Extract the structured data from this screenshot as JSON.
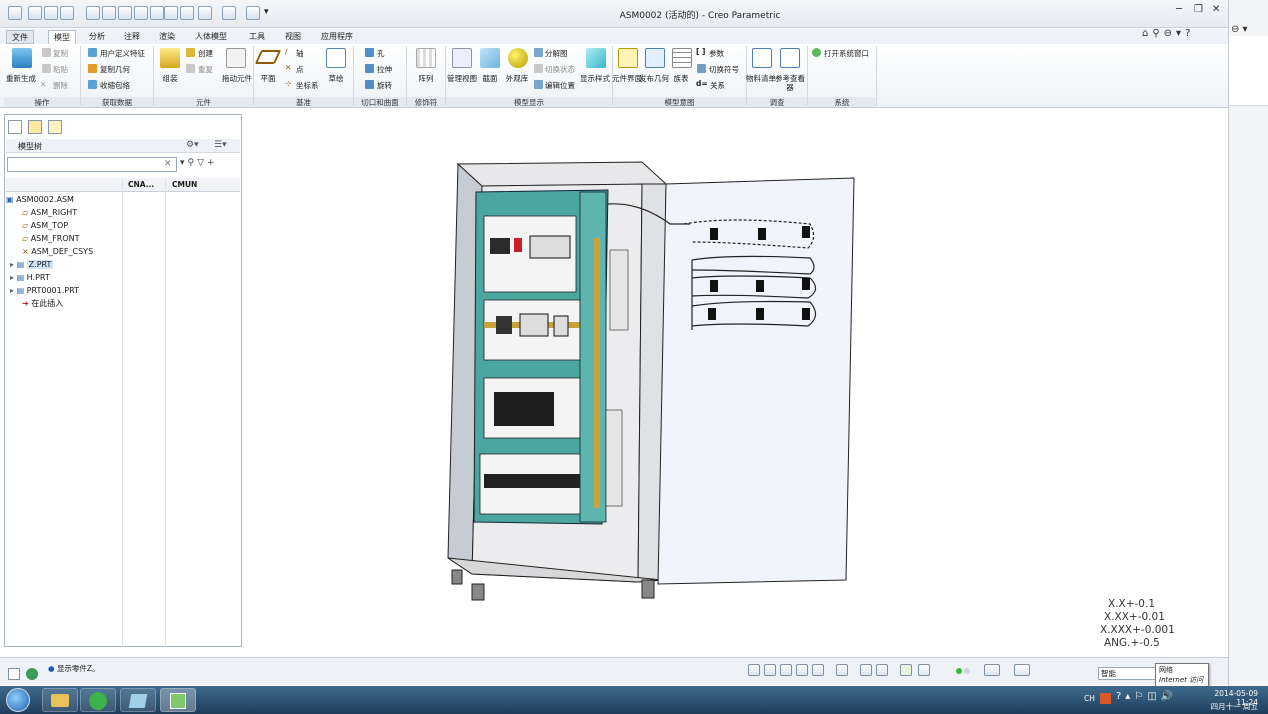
{
  "window": {
    "title": "ASM0002 (活动的) - Creo Parametric"
  },
  "tabs": [
    {
      "label": "文件",
      "file": true
    },
    {
      "label": "模型",
      "active": true
    },
    {
      "label": "分析"
    },
    {
      "label": "注释"
    },
    {
      "label": "渲染"
    },
    {
      "label": "人体模型"
    },
    {
      "label": "工具"
    },
    {
      "label": "视图"
    },
    {
      "label": "应用程序"
    }
  ],
  "ribbon": {
    "regenerate": "重新生成",
    "copy": "复制",
    "paste": "粘贴",
    "delete": "删除",
    "udf": "用户定义特征",
    "copy_geom": "复制几何",
    "shrinkwrap": "收缩包络",
    "assemble": "组装",
    "create": "创建",
    "repeat": "重复",
    "drag": "拖动元件",
    "plane": "平面",
    "axis": "轴",
    "point": "点",
    "csys": "坐标系",
    "sketch": "草绘",
    "hole": "孔",
    "extrude": "拉伸",
    "revolve": "旋转",
    "pattern": "阵列",
    "manage_views": "管理视图",
    "section": "截面",
    "appearance": "外观库",
    "explode": "分解图",
    "toggle_status": "切换状态",
    "edit_position": "编辑位置",
    "display_style": "显示样式",
    "component_interface": "元件界面",
    "publish_geom": "发布几何",
    "table": "族表",
    "parameters": "参数",
    "switch_symbols": "切换符号",
    "relations": "关系",
    "bom": "物料清单",
    "reference_viewer": "参考查看器",
    "open_system_window": "打开系统窗口",
    "groups": {
      "ops": "操作",
      "getdata": "获取数据",
      "component": "元件",
      "datum": "基准",
      "cut_surface": "切口和曲面",
      "modifiers": "修饰符",
      "model_display": "模型显示",
      "model_intent": "模型意图",
      "investigate": "调查",
      "system": "系统"
    }
  },
  "model_tree": {
    "title": "模型树",
    "columns": [
      "CNA...",
      "CMUN"
    ],
    "items": [
      {
        "label": "ASM0002.ASM",
        "indent": 0
      },
      {
        "label": "ASM_RIGHT",
        "indent": 1
      },
      {
        "label": "ASM_TOP",
        "indent": 1
      },
      {
        "label": "ASM_FRONT",
        "indent": 1
      },
      {
        "label": "ASM_DEF_CSYS",
        "indent": 1
      },
      {
        "label": "Z.PRT",
        "indent": 1,
        "selected": true
      },
      {
        "label": "H.PRT",
        "indent": 1
      },
      {
        "label": "PRT0001.PRT",
        "indent": 1
      },
      {
        "label": "在此插入",
        "indent": 1
      }
    ]
  },
  "tolerances": [
    "X.X+-0.1",
    "X.XX+-0.01",
    "X.XXX+-0.001",
    "ANG.+-0.5"
  ],
  "status": {
    "message": "显示零件Z。",
    "filter": "智能"
  },
  "tooltip": {
    "line1": "网络",
    "line2": "Internet 访问"
  },
  "taskbar": {
    "time": "11:24",
    "date": "2014-05-09",
    "weekday": "四月十一 周五",
    "lang": "CH"
  }
}
